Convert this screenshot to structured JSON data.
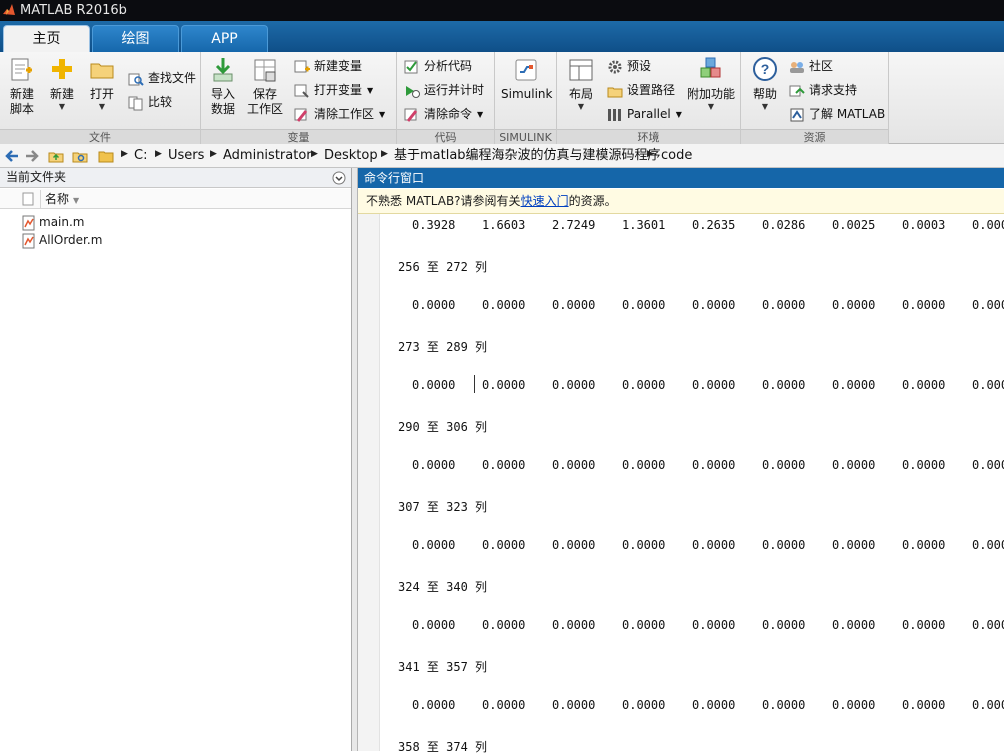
{
  "window": {
    "title": "MATLAB R2016b"
  },
  "tabs": [
    {
      "label": "主页",
      "active": true
    },
    {
      "label": "绘图",
      "active": false
    },
    {
      "label": "APP",
      "active": false
    }
  ],
  "ribbon": {
    "file": {
      "label": "文件",
      "new_script": "新建\n脚本",
      "new": "新建",
      "open": "打开",
      "find_files": "查找文件",
      "compare": "比较"
    },
    "variable": {
      "label": "变量",
      "import": "导入\n数据",
      "save_ws": "保存\n工作区",
      "new_var": "新建变量",
      "open_var": "打开变量",
      "clear_ws": "清除工作区"
    },
    "code": {
      "label": "代码",
      "analyze": "分析代码",
      "run_time": "运行并计时",
      "clear_cmd": "清除命令"
    },
    "simulink": {
      "label": "SIMULINK",
      "simulink": "Simulink"
    },
    "env": {
      "label": "环境",
      "layout": "布局",
      "prefs": "预设",
      "set_path": "设置路径",
      "parallel": "Parallel",
      "addons": "附加功能"
    },
    "resources": {
      "label": "资源",
      "help": "帮助",
      "community": "社区",
      "support": "请求支持",
      "learn": "了解 MATLAB"
    }
  },
  "address": {
    "crumbs": [
      "C:",
      "Users",
      "Administrator",
      "Desktop",
      "基于matlab编程海杂波的仿真与建模源码程序",
      "code"
    ]
  },
  "current_folder": {
    "title": "当前文件夹",
    "col_name": "名称",
    "files": [
      "main.m",
      "AllOrder.m"
    ]
  },
  "command_window": {
    "title": "命令行窗口",
    "notice_pre": "不熟悉 MATLAB?请参阅有关",
    "notice_link": "快速入门",
    "notice_post": "的资源。",
    "first_row": [
      "0.3928",
      "1.6603",
      "2.7249",
      "1.3601",
      "0.2635",
      "0.0286",
      "0.0025",
      "0.0003",
      "0.000"
    ],
    "blocks": [
      {
        "header": "256 至 272 列",
        "values": [
          "0.0000",
          "0.0000",
          "0.0000",
          "0.0000",
          "0.0000",
          "0.0000",
          "0.0000",
          "0.0000",
          "0.000"
        ]
      },
      {
        "header": "273 至 289 列",
        "values": [
          "0.0000",
          "0.0000",
          "0.0000",
          "0.0000",
          "0.0000",
          "0.0000",
          "0.0000",
          "0.0000",
          "0.000"
        ]
      },
      {
        "header": "290 至 306 列",
        "values": [
          "0.0000",
          "0.0000",
          "0.0000",
          "0.0000",
          "0.0000",
          "0.0000",
          "0.0000",
          "0.0000",
          "0.000"
        ]
      },
      {
        "header": "307 至 323 列",
        "values": [
          "0.0000",
          "0.0000",
          "0.0000",
          "0.0000",
          "0.0000",
          "0.0000",
          "0.0000",
          "0.0000",
          "0.000"
        ]
      },
      {
        "header": "324 至 340 列",
        "values": [
          "0.0000",
          "0.0000",
          "0.0000",
          "0.0000",
          "0.0000",
          "0.0000",
          "0.0000",
          "0.0000",
          "0.000"
        ]
      },
      {
        "header": "341 至 357 列",
        "values": [
          "0.0000",
          "0.0000",
          "0.0000",
          "0.0000",
          "0.0000",
          "0.0000",
          "0.0000",
          "0.0000",
          "0.000"
        ]
      },
      {
        "header": "358 至 374 列",
        "values": []
      }
    ]
  }
}
